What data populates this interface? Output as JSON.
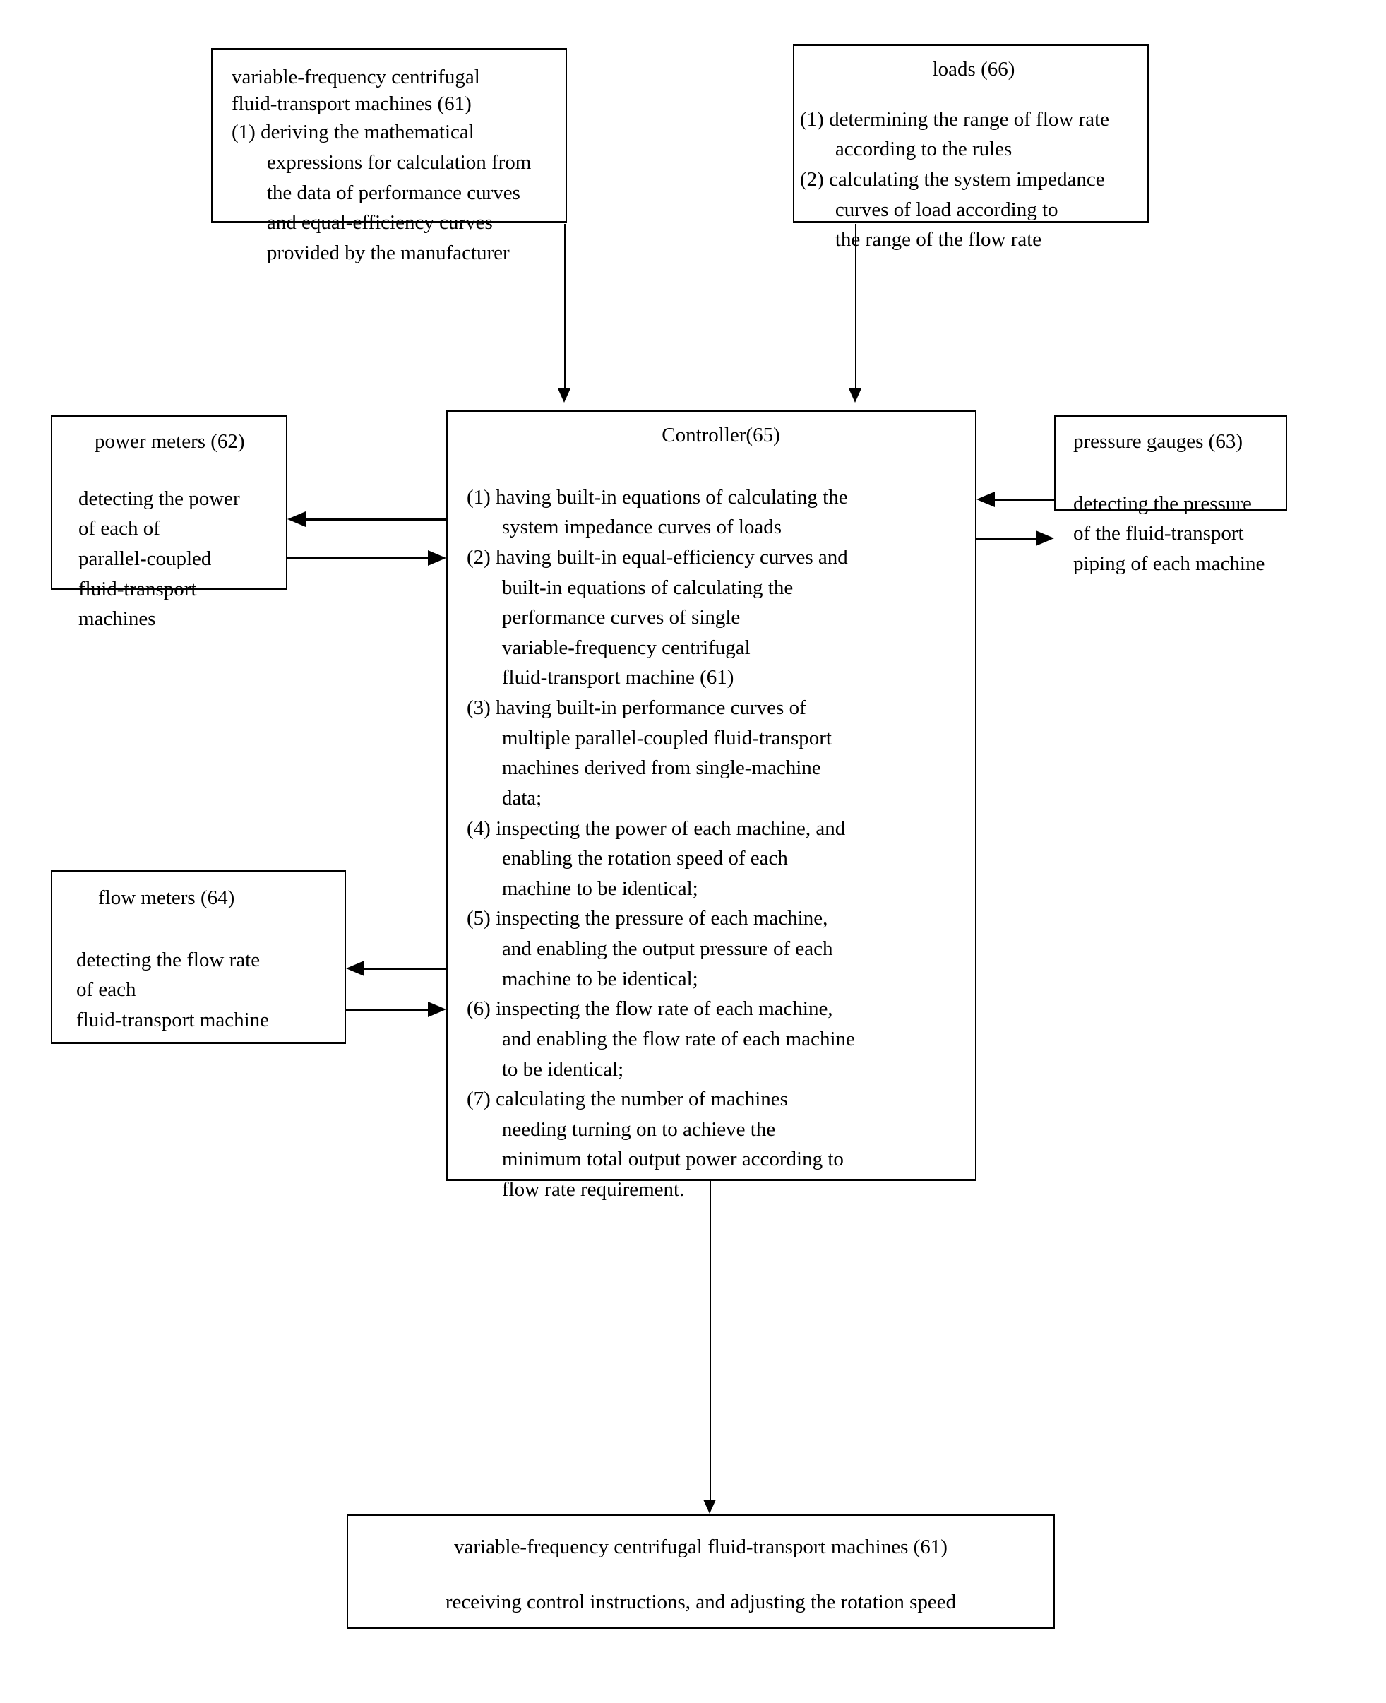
{
  "figure": {
    "type": "patent-flow-diagram",
    "boxes": {
      "machines_top": {
        "title_line1": "variable-frequency centrifugal",
        "title_line2": "fluid-transport machines (61)",
        "items": [
          "(1) deriving the mathematical",
          "expressions for calculation from",
          "the data of performance curves",
          "and equal-efficiency curves",
          "provided by the manufacturer"
        ]
      },
      "loads": {
        "title": "loads (66)",
        "items": [
          "(1) determining the range of flow rate",
          "according to the rules",
          "(2) calculating the system impedance",
          "curves of load according to",
          "the range of the flow rate"
        ]
      },
      "power_meters": {
        "title": "power meters (62)",
        "items": [
          "detecting the power",
          "of each of",
          "parallel-coupled",
          "fluid-transport",
          "machines"
        ]
      },
      "pressure_gauges": {
        "title": "pressure gauges (63)",
        "items": [
          "detecting the pressure",
          "of the fluid-transport",
          "piping of each machine"
        ]
      },
      "flow_meters": {
        "title": "flow meters (64)",
        "items": [
          "detecting the flow rate",
          "of each",
          "fluid-transport machine"
        ]
      },
      "controller": {
        "title": "Controller(65)",
        "items": [
          "(1) having built-in equations of calculating the",
          "system impedance curves of loads",
          "(2) having built-in equal-efficiency curves and",
          "built-in equations of calculating the",
          "performance curves of single",
          "variable-frequency centrifugal",
          "fluid-transport machine (61)",
          "(3) having built-in performance curves of",
          "multiple parallel-coupled fluid-transport",
          "machines derived from single-machine",
          "data;",
          "(4) inspecting the power of each machine, and",
          "enabling the rotation speed of each",
          "machine to be identical;",
          "(5) inspecting the pressure of each machine,",
          "and enabling the output pressure of each",
          "machine to be identical;",
          "(6) inspecting the flow rate of each machine,",
          "and enabling the flow rate of each machine",
          "to be identical;",
          "(7) calculating the number of machines",
          "needing turning on to achieve the",
          "minimum total output power according to",
          "flow rate requirement."
        ]
      },
      "machines_bottom": {
        "title": "variable-frequency centrifugal fluid-transport machines (61)",
        "subtitle": "receiving control instructions, and adjusting the rotation speed"
      }
    },
    "connectors": [
      {
        "name": "machines-top-to-controller",
        "direction": "down"
      },
      {
        "name": "loads-to-controller",
        "direction": "down"
      },
      {
        "name": "controller-to-power-meters",
        "direction": "left"
      },
      {
        "name": "power-meters-to-controller",
        "direction": "right"
      },
      {
        "name": "controller-to-pressure-gauges",
        "direction": "left"
      },
      {
        "name": "pressure-gauges-to-controller",
        "direction": "right"
      },
      {
        "name": "controller-to-flow-meters",
        "direction": "left"
      },
      {
        "name": "flow-meters-to-controller",
        "direction": "right"
      },
      {
        "name": "controller-to-machines-bottom",
        "direction": "down"
      }
    ],
    "colors": {
      "ink": "#000000",
      "paper": "#ffffff"
    }
  }
}
